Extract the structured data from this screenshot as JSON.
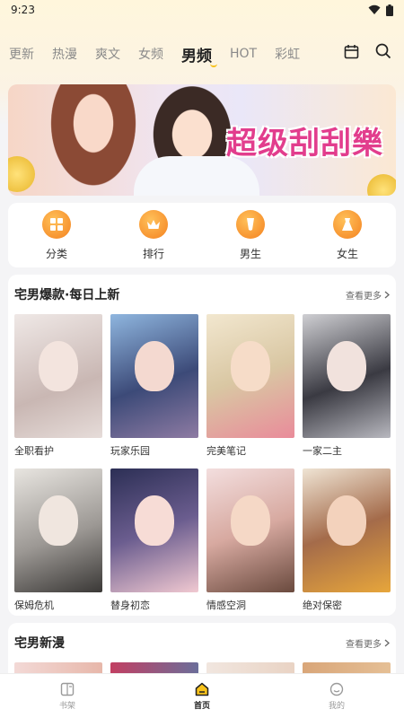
{
  "status": {
    "time": "9:23"
  },
  "nav": {
    "tabs": [
      "更新",
      "热漫",
      "爽文",
      "女频",
      "男频",
      "HOT",
      "彩虹"
    ],
    "active_index": 4
  },
  "banner": {
    "title": "超级刮刮樂"
  },
  "categories": [
    {
      "label": "分类",
      "icon": "grid-icon"
    },
    {
      "label": "排行",
      "icon": "crown-icon"
    },
    {
      "label": "男生",
      "icon": "male-icon"
    },
    {
      "label": "女生",
      "icon": "female-icon"
    }
  ],
  "section1": {
    "title": "宅男爆款·每日上新",
    "more": "查看更多",
    "items": [
      {
        "title": "全职看护"
      },
      {
        "title": "玩家乐园"
      },
      {
        "title": "完美笔记"
      },
      {
        "title": "一家二主"
      },
      {
        "title": "保姆危机"
      },
      {
        "title": "替身初恋"
      },
      {
        "title": "情感空洞"
      },
      {
        "title": "绝对保密"
      }
    ]
  },
  "section2": {
    "title": "宅男新漫",
    "more": "查看更多"
  },
  "bottom_nav": [
    {
      "label": "书架"
    },
    {
      "label": "首页"
    },
    {
      "label": "我的"
    }
  ],
  "colors": {
    "accent": "#f4811f",
    "banner_title": "#e23d8d",
    "indicator": "#f7c21b"
  }
}
